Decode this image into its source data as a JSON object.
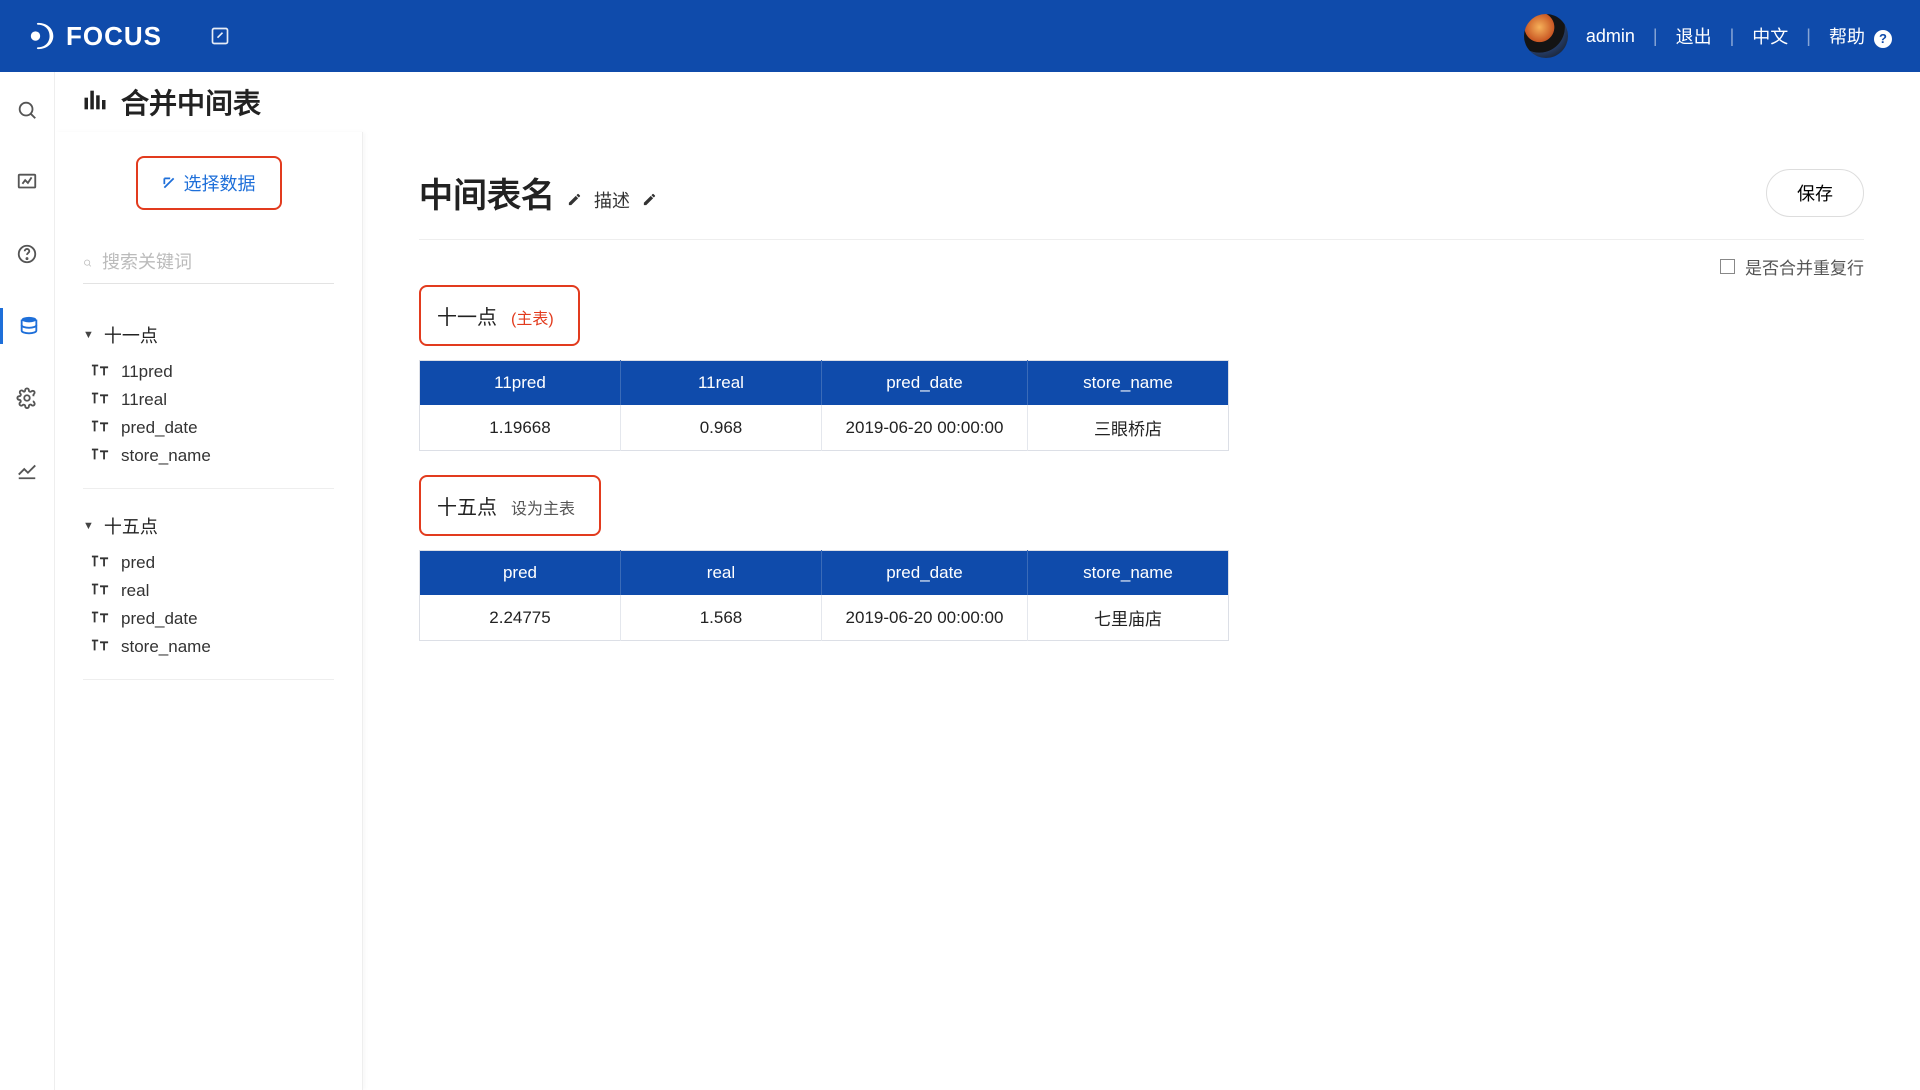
{
  "brand": "FOCUS",
  "topbar": {
    "user": "admin",
    "logout": "退出",
    "language": "中文",
    "help": "帮助"
  },
  "page": {
    "title": "合并中间表"
  },
  "sidepanel": {
    "select_data": "选择数据",
    "search_placeholder": "搜索关键词",
    "groups": [
      {
        "name": "十一点",
        "fields": [
          "11pred",
          "11real",
          "pred_date",
          "store_name"
        ]
      },
      {
        "name": "十五点",
        "fields": [
          "pred",
          "real",
          "pred_date",
          "store_name"
        ]
      }
    ]
  },
  "main": {
    "table_name": "中间表名",
    "description_label": "描述",
    "save": "保存",
    "merge_dup_label": "是否合并重复行",
    "sections": [
      {
        "title": "十一点",
        "badge": "(主表)",
        "action": "",
        "columns": [
          "11pred",
          "11real",
          "pred_date",
          "store_name"
        ],
        "rows": [
          [
            "1.19668",
            "0.968",
            "2019-06-20 00:00:00",
            "三眼桥店"
          ]
        ]
      },
      {
        "title": "十五点",
        "badge": "",
        "action": "设为主表",
        "columns": [
          "pred",
          "real",
          "pred_date",
          "store_name"
        ],
        "rows": [
          [
            "2.24775",
            "1.568",
            "2019-06-20 00:00:00",
            "七里庙店"
          ]
        ]
      }
    ]
  }
}
